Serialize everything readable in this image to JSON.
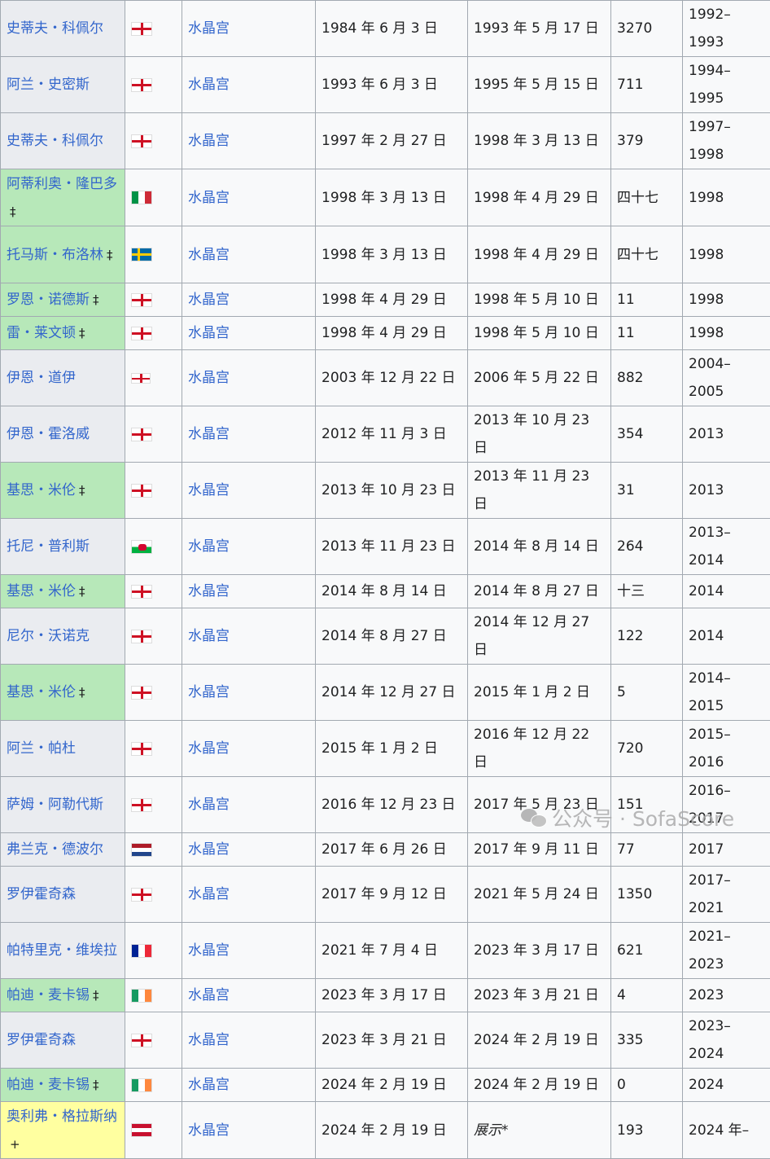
{
  "rows": [
    {
      "name": "史蒂夫・科佩尔",
      "mark": "",
      "type": "normal",
      "flag": "england",
      "club": "水晶宫",
      "start": "1984 年 6 月 3 日",
      "end": "1993 年 5 月 17 日",
      "days": "3270",
      "seasons": "1992–1993"
    },
    {
      "name": "阿兰・史密斯",
      "mark": "",
      "type": "normal",
      "flag": "england",
      "club": "水晶宫",
      "start": "1993 年 6 月 3 日",
      "end": "1995 年 5 月 15 日",
      "days": "711",
      "seasons": "1994–1995"
    },
    {
      "name": "史蒂夫・科佩尔",
      "mark": "",
      "type": "normal",
      "flag": "england",
      "club": "水晶宫",
      "start": "1997 年 2 月 27 日",
      "end": "1998 年 3 月 13 日",
      "days": "379",
      "seasons": "1997–1998"
    },
    {
      "name": "阿蒂利奥・隆巴多",
      "mark": "‡",
      "type": "caretaker",
      "flag": "italy",
      "club": "水晶宫",
      "start": "1998 年 3 月 13 日",
      "end": "1998 年 4 月 29 日",
      "days": "四十七",
      "seasons": "1998"
    },
    {
      "name": "托马斯・布洛林",
      "mark": "‡",
      "type": "caretaker",
      "flag": "sweden",
      "club": "水晶宫",
      "start": "1998 年 3 月 13 日",
      "end": "1998 年 4 月 29 日",
      "days": "四十七",
      "seasons": "1998"
    },
    {
      "name": "罗恩・诺德斯",
      "mark": "‡",
      "type": "caretaker",
      "flag": "england",
      "club": "水晶宫",
      "start": "1998 年 4 月 29 日",
      "end": "1998 年 5 月 10 日",
      "days": "11",
      "seasons": "1998"
    },
    {
      "name": "雷・莱文顿",
      "mark": "‡",
      "type": "caretaker",
      "flag": "england",
      "club": "水晶宫",
      "start": "1998 年 4 月 29 日",
      "end": "1998 年 5 月 10 日",
      "days": "11",
      "seasons": "1998"
    },
    {
      "name": "伊恩・道伊",
      "mark": "",
      "type": "normal",
      "flag": "northern-ireland",
      "club": "水晶宫",
      "start": "2003 年 12 月 22 日",
      "end": "2006 年 5 月 22 日",
      "days": "882",
      "seasons": "2004–2005"
    },
    {
      "name": "伊恩・霍洛威",
      "mark": "",
      "type": "normal",
      "flag": "england",
      "club": "水晶宫",
      "start": "2012 年 11 月 3 日",
      "end": "2013 年 10 月 23 日",
      "days": "354",
      "seasons": "2013"
    },
    {
      "name": "基思・米伦",
      "mark": "‡",
      "type": "caretaker",
      "flag": "england",
      "club": "水晶宫",
      "start": "2013 年 10 月 23 日",
      "end": "2013 年 11 月 23 日",
      "days": "31",
      "seasons": "2013"
    },
    {
      "name": "托尼・普利斯",
      "mark": "",
      "type": "normal",
      "flag": "wales",
      "club": "水晶宫",
      "start": "2013 年 11 月 23 日",
      "end": "2014 年 8 月 14 日",
      "days": "264",
      "seasons": "2013–2014"
    },
    {
      "name": "基思・米伦",
      "mark": "‡",
      "type": "caretaker",
      "flag": "england",
      "club": "水晶宫",
      "start": "2014 年 8 月 14 日",
      "end": "2014 年 8 月 27 日",
      "days": "十三",
      "seasons": "2014"
    },
    {
      "name": "尼尔・沃诺克",
      "mark": "",
      "type": "normal",
      "flag": "england",
      "club": "水晶宫",
      "start": "2014 年 8 月 27 日",
      "end": "2014 年 12 月 27 日",
      "days": "122",
      "seasons": "2014"
    },
    {
      "name": "基思・米伦",
      "mark": "‡",
      "type": "caretaker",
      "flag": "england",
      "club": "水晶宫",
      "start": "2014 年 12 月 27 日",
      "end": "2015 年 1 月 2 日",
      "days": "5",
      "seasons": "2014–2015"
    },
    {
      "name": "阿兰・帕杜",
      "mark": "",
      "type": "normal",
      "flag": "england",
      "club": "水晶宫",
      "start": "2015 年 1 月 2 日",
      "end": "2016 年 12 月 22 日",
      "days": "720",
      "seasons": "2015–2016"
    },
    {
      "name": "萨姆・阿勒代斯",
      "mark": "",
      "type": "normal",
      "flag": "england",
      "club": "水晶宫",
      "start": "2016 年 12 月 23 日",
      "end": "2017 年 5 月 23 日",
      "days": "151",
      "seasons": "2016–2017"
    },
    {
      "name": "弗兰克・德波尔",
      "mark": "",
      "type": "normal",
      "flag": "netherlands",
      "club": "水晶宫",
      "start": "2017 年 6 月 26 日",
      "end": "2017 年 9 月 11 日",
      "days": "77",
      "seasons": "2017"
    },
    {
      "name": "罗伊霍奇森",
      "mark": "",
      "type": "normal",
      "flag": "england",
      "club": "水晶宫",
      "start": "2017 年 9 月 12 日",
      "end": "2021 年 5 月 24 日",
      "days": "1350",
      "seasons": "2017–2021"
    },
    {
      "name": "帕特里克・维埃拉",
      "mark": "",
      "type": "normal",
      "flag": "france",
      "club": "水晶宫",
      "start": "2021 年 7 月 4 日",
      "end": "2023 年 3 月 17 日",
      "days": "621",
      "seasons": "2021–2023"
    },
    {
      "name": "帕迪・麦卡锡",
      "mark": "‡",
      "type": "caretaker",
      "flag": "ireland",
      "club": "水晶宫",
      "start": "2023 年 3 月 17 日",
      "end": "2023 年 3 月 21 日",
      "days": "4",
      "seasons": "2023"
    },
    {
      "name": "罗伊霍奇森",
      "mark": "",
      "type": "normal",
      "flag": "england",
      "club": "水晶宫",
      "start": "2023 年 3 月 21 日",
      "end": "2024 年 2 月 19 日",
      "days": "335",
      "seasons": "2023–2024"
    },
    {
      "name": "帕迪・麦卡锡",
      "mark": "‡",
      "type": "caretaker",
      "flag": "ireland",
      "club": "水晶宫",
      "start": "2024 年 2 月 19 日",
      "end": "2024 年 2 月 19 日",
      "days": "0",
      "seasons": "2024"
    },
    {
      "name": "奥利弗・格拉斯纳",
      "mark": "+",
      "type": "current",
      "flag": "austria",
      "club": "水晶宫",
      "start": "2024 年 2 月 19 日",
      "end": "展示*",
      "days": "193",
      "seasons": "2024 年–"
    }
  ],
  "watermark": "公众号 · SofaScore",
  "colors": {
    "link": "#3366cc",
    "caretaker": "#b7e8b9",
    "current": "#ffffa0",
    "border": "#a2a9b1"
  }
}
